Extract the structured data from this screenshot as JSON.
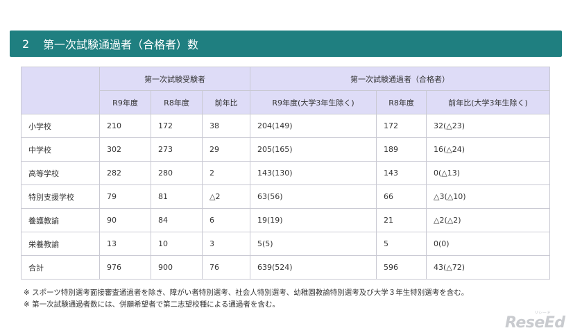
{
  "header": {
    "number": "2",
    "title": "第一次試験通過者（合格者）数"
  },
  "table": {
    "group_headers": [
      "第一次試験受験者",
      "第一次試験通過者（合格者）"
    ],
    "sub_headers": [
      "R9年度",
      "R8年度",
      "前年比",
      "R9年度(大学3年生除く)",
      "R8年度",
      "前年比(大学3年生除く)"
    ],
    "rows": [
      {
        "label": "小学校",
        "cells": [
          "210",
          "172",
          "38",
          "204(149)",
          "172",
          "32(△23)"
        ]
      },
      {
        "label": "中学校",
        "cells": [
          "302",
          "273",
          "29",
          "205(165)",
          "189",
          "16(△24)"
        ]
      },
      {
        "label": "高等学校",
        "cells": [
          "282",
          "280",
          "2",
          "143(130)",
          "143",
          "0(△13)"
        ]
      },
      {
        "label": "特別支援学校",
        "cells": [
          "79",
          "81",
          "△2",
          "63(56)",
          "66",
          "△3(△10)"
        ]
      },
      {
        "label": "養護教諭",
        "cells": [
          "90",
          "84",
          "6",
          "19(19)",
          "21",
          "△2(△2)"
        ]
      },
      {
        "label": "栄養教諭",
        "cells": [
          "13",
          "10",
          "3",
          "5(5)",
          "5",
          "0(0)"
        ]
      },
      {
        "label": "合計",
        "cells": [
          "976",
          "900",
          "76",
          "639(524)",
          "596",
          "43(△72)"
        ]
      }
    ]
  },
  "notes": [
    "※ スポーツ特別選考面接審査通過者を除き、障がい者特別選考、社会人特別選考、幼稚園教諭特別選考及び大学３年生特別選考を含む。",
    "※ 第一次試験通過者数には、併願希望者で第二志望校種による通過者を含む。"
  ],
  "logo": {
    "text": "ReseEd",
    "sub": "リシード"
  }
}
